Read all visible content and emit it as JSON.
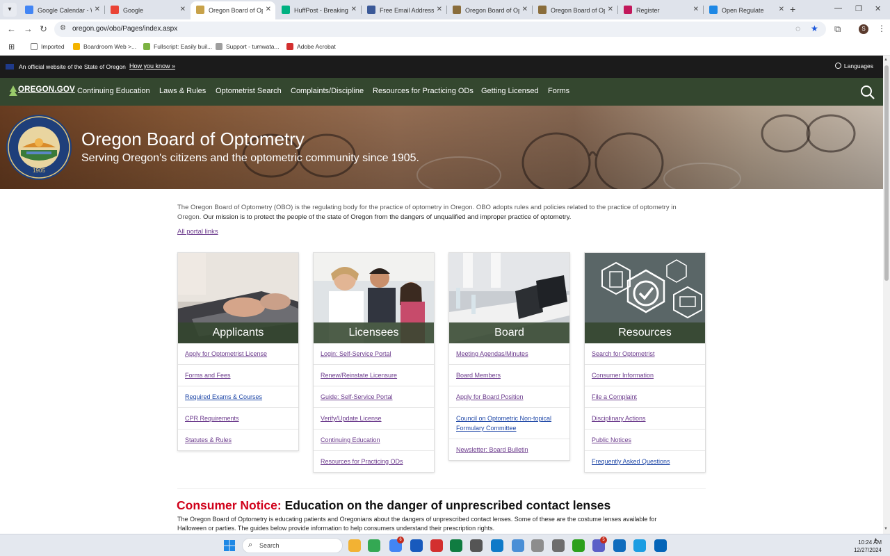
{
  "browser": {
    "tabs": [
      {
        "label": "Google Calendar - W",
        "color": "#4285f4",
        "active": false
      },
      {
        "label": "Google",
        "color": "#ea4335",
        "active": false
      },
      {
        "label": "Oregon Board of Opt",
        "color": "#c8a24a",
        "active": true
      },
      {
        "label": "HuffPost - Breaking N",
        "color": "#00b181",
        "active": false
      },
      {
        "label": "Free Email Addresses",
        "color": "#3b5998",
        "active": false
      },
      {
        "label": "Oregon Board of Opt",
        "color": "#8a6d3b",
        "active": false
      },
      {
        "label": "Oregon Board of Opt",
        "color": "#8a6d3b",
        "active": false
      },
      {
        "label": "Register",
        "color": "#c2185b",
        "active": false
      },
      {
        "label": "Open Regulate",
        "color": "#1e88e5",
        "active": false
      }
    ],
    "url": "oregon.gov/obo/Pages/index.aspx",
    "profile_initial": "S",
    "bookmarks": [
      {
        "label": "Imported",
        "color": "#777777"
      },
      {
        "label": "Boardroom Web >...",
        "color": "#f4b400"
      },
      {
        "label": "Fullscript: Easily buil...",
        "color": "#7cb342"
      },
      {
        "label": "Support - tumwata...",
        "color": "#9e9e9e"
      },
      {
        "label": "Adobe Acrobat",
        "color": "#d32f2f"
      }
    ]
  },
  "banner": {
    "official_text": "An official website of the State of Oregon",
    "how_you_know": "How you know »",
    "languages": "Languages"
  },
  "nav": {
    "logo": "OREGON.GOV",
    "links": [
      "Continuing Education",
      "Laws & Rules",
      "Optometrist Search",
      "Complaints/Discipline",
      "Resources for Practicing ODs",
      "Getting Licensed",
      "Forms"
    ]
  },
  "hero": {
    "title": "Oregon Board of Optometry",
    "subtitle": "Serving Oregon's citizens and the optometric community since 1905.",
    "seal_year": "1905",
    "seal_text": "OREGON BOARD OF OPTOMETRY"
  },
  "intro": {
    "text": " The Oregon Board of Optometry (OBO) is the regulating body for the practice of optometry in Oregon. OBO adopts rules and policies related to the practice of optometry in Oregon. ",
    "mission": "Our mission is to protect the people of the state of Oregon from the dangers of unqualified and improper practice of optometry.",
    "portal_link": "All portal links"
  },
  "cards": [
    {
      "title": "Applicants",
      "links": [
        "Apply for Optometrist License",
        "Forms and Fees",
        "Required Exams & Courses",
        "CPR Requirements",
        "Statutes & Rules"
      ]
    },
    {
      "title": "Licensees",
      "links": [
        "Login: Self-Service Portal",
        "Renew/Reinstate Licensure",
        "Guide: Self-Service Portal",
        "Verify/Update License",
        "Continuing Education",
        "Resources for Practicing ODs"
      ]
    },
    {
      "title": "Board",
      "links": [
        "Meeting Agendas/Minutes",
        "Board Members",
        "Apply for Board Position",
        "Council on Optometric Non-topical Formulary Committee",
        "Newsletter: Board Bulletin"
      ]
    },
    {
      "title": "Resources",
      "links": [
        "Search for Optometrist",
        "Consumer Information",
        "File a Complaint",
        "Disciplinary Actions",
        "Public Notices",
        "Frequently Asked Questions"
      ]
    }
  ],
  "notice": {
    "label": "Consumer Notice:",
    "title": " Education on the danger of unprescribed contact lenses",
    "body": "The Oregon Board of Optometry is educating patients and Oregonians about the dangers of unprescribed contact lenses. Some of these are the costume lenses available for Halloween or parties. The guides below provide information to help consumers understand their prescription rights."
  },
  "taskbar": {
    "search_placeholder": "Search",
    "time": "10:24 AM",
    "date": "12/27/2024",
    "apps": [
      {
        "name": "file-explorer",
        "color": "#f2b233"
      },
      {
        "name": "chrome",
        "color": "#34a853"
      },
      {
        "name": "chrome-profile",
        "color": "#4285f4",
        "badge": "6"
      },
      {
        "name": "word",
        "color": "#185abd"
      },
      {
        "name": "acrobat",
        "color": "#d32f2f"
      },
      {
        "name": "excel",
        "color": "#107c41"
      },
      {
        "name": "printer",
        "color": "#555555"
      },
      {
        "name": "photos",
        "color": "#0f7ac8"
      },
      {
        "name": "notepad",
        "color": "#4a8fd6"
      },
      {
        "name": "wordpad",
        "color": "#8d8d8d"
      },
      {
        "name": "calculator",
        "color": "#6d6d6d"
      },
      {
        "name": "quickbooks",
        "color": "#2ca01c"
      },
      {
        "name": "teams",
        "color": "#5b5fc7",
        "badge": "5"
      },
      {
        "name": "outlook-new",
        "color": "#0f6cbd"
      },
      {
        "name": "edge",
        "color": "#1b9de2"
      },
      {
        "name": "outlook",
        "color": "#0364b8"
      }
    ]
  }
}
